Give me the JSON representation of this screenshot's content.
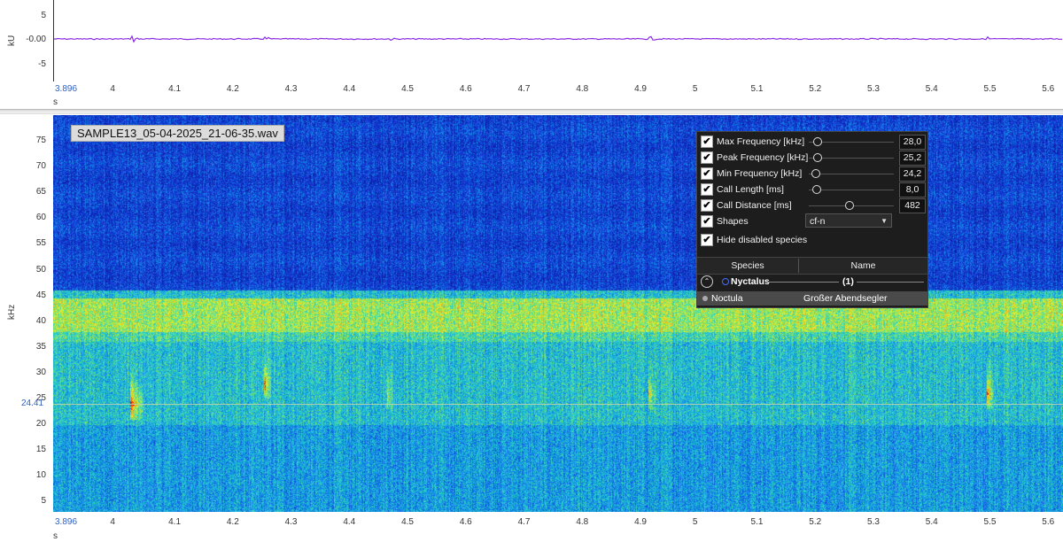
{
  "waveform": {
    "y_unit": "kU",
    "y_ticks": [
      "5",
      "-0.00",
      "-5"
    ],
    "x_unit": "s",
    "color": "#8a2be2"
  },
  "time_axis": {
    "start_label": "3.896",
    "ticks": [
      "4",
      "4.1",
      "4.2",
      "4.3",
      "4.4",
      "4.5",
      "4.6",
      "4.7",
      "4.8",
      "4.9",
      "5",
      "5.1",
      "5.2",
      "5.3",
      "5.4",
      "5.5",
      "5.6"
    ],
    "unit": "s"
  },
  "spectrogram": {
    "file_name": "SAMPLE13_05-04-2025_21-06-35.wav",
    "y_unit": "kHz",
    "y_ticks": [
      "75",
      "70",
      "65",
      "60",
      "55",
      "50",
      "45",
      "40",
      "35",
      "30",
      "25",
      "20",
      "15",
      "10",
      "5"
    ],
    "marker_label": "24.41",
    "freq_range_khz": [
      3,
      80
    ],
    "time_range_s": [
      3.896,
      5.63
    ],
    "bright_band_khz": [
      38,
      45
    ],
    "calls": [
      {
        "t": 4.03,
        "f": 23
      },
      {
        "t": 4.26,
        "f": 27
      },
      {
        "t": 4.47,
        "f": 25
      },
      {
        "t": 4.92,
        "f": 25
      },
      {
        "t": 5.5,
        "f": 25
      }
    ]
  },
  "panel": {
    "params": [
      {
        "label": "Max Frequency [kHz]",
        "value": "28,0",
        "level": 0.06
      },
      {
        "label": "Peak Frequency [kHz]",
        "value": "25,2",
        "level": 0.05
      },
      {
        "label": "Min Frequency [kHz]",
        "value": "24,2",
        "level": 0.03
      },
      {
        "label": "Call Length [ms]",
        "value": "8,0",
        "level": 0.04
      },
      {
        "label": "Call Distance [ms]",
        "value": "482",
        "level": 0.45
      }
    ],
    "shapes_label": "Shapes",
    "shapes_value": "cf-n",
    "hide_disabled_label": "Hide disabled species",
    "col_species": "Species",
    "col_name": "Name",
    "group_name": "Nyctalus",
    "group_count": "(1)",
    "species_name": "Noctula",
    "species_common": "Großer Abendsegler"
  }
}
